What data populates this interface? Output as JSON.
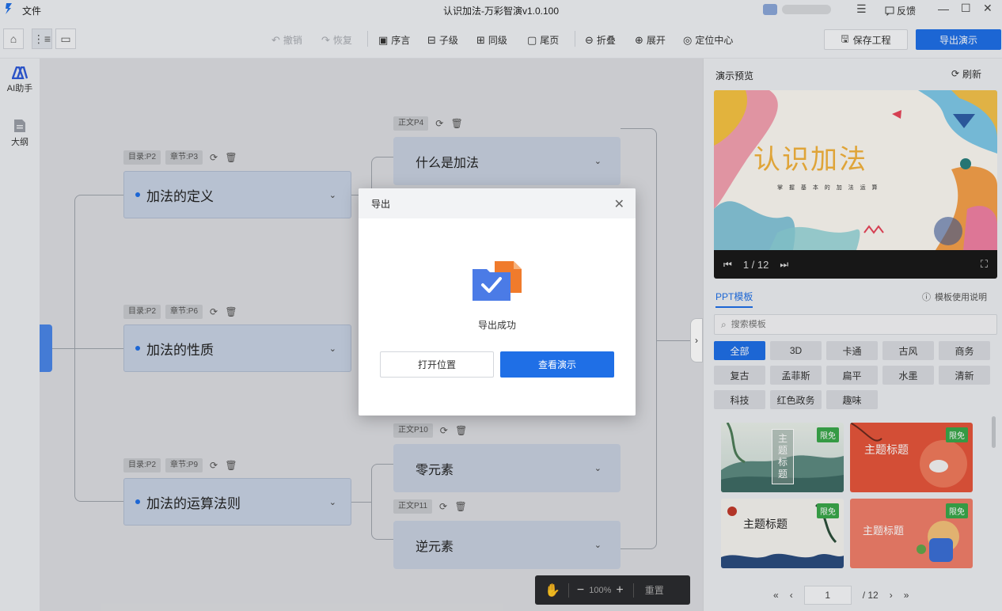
{
  "titlebar": {
    "menu_file": "文件",
    "title": "认识加法-万彩智演v1.0.100",
    "feedback": "反馈"
  },
  "toolbar": {
    "undo": "撤销",
    "redo": "恢复",
    "preface": "序言",
    "child": "子级",
    "sibling": "同级",
    "tail": "尾页",
    "collapse": "折叠",
    "expand": "展开",
    "locate": "定位中心",
    "save": "保存工程",
    "export": "导出演示"
  },
  "rail": {
    "ai": "AI助手",
    "outline": "大纲"
  },
  "mindmap": {
    "chapters": [
      {
        "toc": "目录:P2",
        "chap": "章节:P3",
        "label": "加法的定义"
      },
      {
        "toc": "目录:P2",
        "chap": "章节:P6",
        "label": "加法的性质"
      },
      {
        "toc": "目录:P2",
        "chap": "章节:P9",
        "label": "加法的运算法则"
      }
    ],
    "topics": [
      {
        "page": "正文P4",
        "label": "什么是加法"
      },
      {
        "page": "正文P10",
        "label": "零元素"
      },
      {
        "page": "正文P11",
        "label": "逆元素"
      }
    ]
  },
  "zoombar": {
    "zoom": "100%",
    "reset": "重置"
  },
  "preview": {
    "title": "演示预览",
    "refresh": "刷新",
    "slide_title": "认识加法",
    "slide_subtitle": "掌 握 基 本 的 加 法 运 算",
    "page": "1 / 12"
  },
  "templates": {
    "tab": "PPT模板",
    "help": "模板使用说明",
    "search_placeholder": "搜索模板",
    "categories": [
      "全部",
      "3D",
      "卡通",
      "古风",
      "商务",
      "复古",
      "孟菲斯",
      "扁平",
      "水墨",
      "清新",
      "科技",
      "红色政务",
      "趣味"
    ],
    "badge": "限免",
    "thumb_title": "主题标题",
    "thumb_title_v": "主 题 标 题",
    "page_current": "1",
    "page_total": "/ 12"
  },
  "modal": {
    "title": "导出",
    "message": "导出成功",
    "open_location": "打开位置",
    "view_demo": "查看演示"
  },
  "colors": {
    "accent": "#1f6fe6",
    "badge": "#3aa84a"
  }
}
